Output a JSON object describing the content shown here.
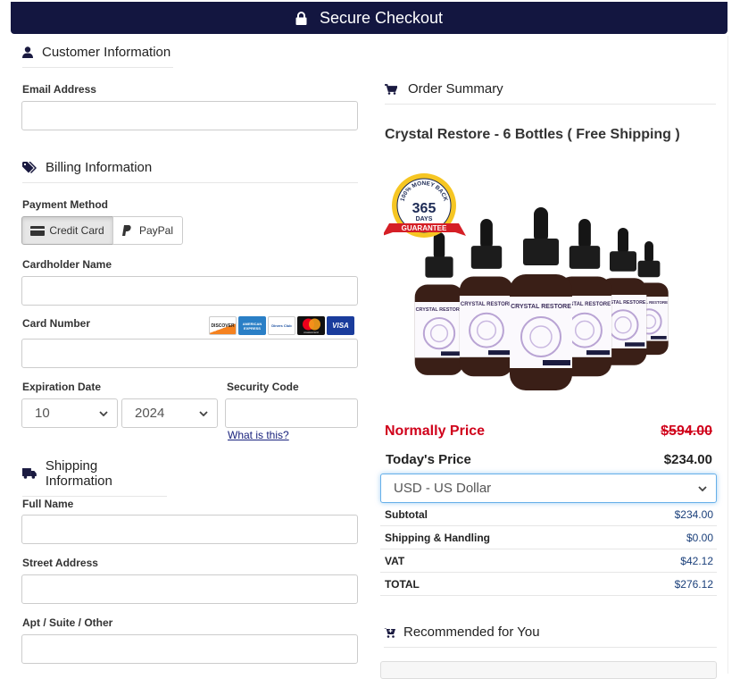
{
  "header": {
    "title": "Secure Checkout",
    "icon": "lock-icon",
    "bg_color": "#131640"
  },
  "customer": {
    "title": "Customer Information",
    "email_label": "Email Address",
    "email_value": ""
  },
  "billing": {
    "title": "Billing Information",
    "payment_method_label": "Payment Method",
    "methods": [
      {
        "label": "Credit Card",
        "icon": "credit-card-icon",
        "selected": true
      },
      {
        "label": "PayPal",
        "icon": "paypal-icon",
        "selected": false
      }
    ],
    "cardholder_label": "Cardholder Name",
    "card_number_label": "Card Number",
    "card_brands": [
      "DISCOVER",
      "AMERICAN EXPRESS",
      "Diners Club",
      "mastercard",
      "VISA"
    ],
    "expiration_label": "Expiration Date",
    "exp_month": "10",
    "exp_year": "2024",
    "security_label": "Security Code",
    "what_is_this": "What is this?"
  },
  "shipping": {
    "title": "Shipping Information",
    "full_name_label": "Full Name",
    "street_label": "Street Address",
    "apt_label": "Apt / Suite / Other"
  },
  "order": {
    "title": "Order Summary",
    "product_name": "Crystal Restore - 6 Bottles ( Free Shipping )",
    "badge": {
      "number": "365",
      "days": "DAYS",
      "ribbon": "GUARANTEE",
      "arc": "100% MONEY BACK"
    },
    "brand_label": "CRYSTAL RESTORE",
    "normal_price_label": "Normally Price",
    "normal_price": "$594.00",
    "today_label": "Today's Price",
    "today_price": "$234.00",
    "currency": "USD - US Dollar",
    "rows": [
      {
        "label": "Subtotal",
        "value": "$234.00"
      },
      {
        "label": "Shipping & Handling",
        "value": "$0.00"
      },
      {
        "label": "VAT",
        "value": "$42.12"
      },
      {
        "label": "TOTAL",
        "value": "$276.12"
      }
    ],
    "accent_red": "#d0021b"
  },
  "recommended": {
    "title": "Recommended for You"
  }
}
